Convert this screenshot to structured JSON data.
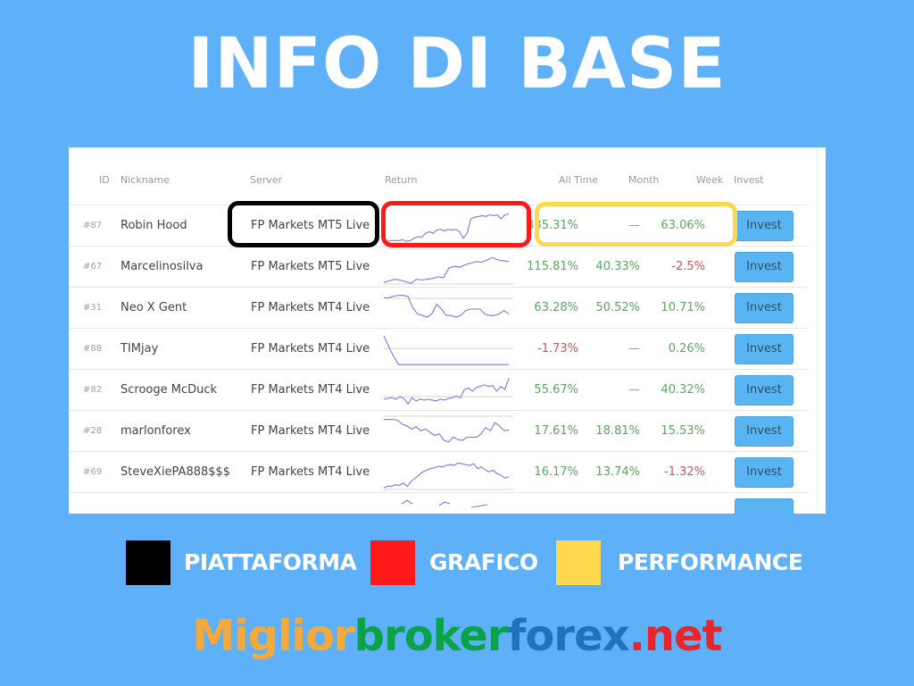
{
  "title": "INFO DI BASE",
  "table": {
    "headers": {
      "id": "ID",
      "nickname": "Nickname",
      "server": "Server",
      "return": "Return",
      "all_time": "All Time",
      "month": "Month",
      "week": "Week",
      "invest": "Invest"
    },
    "rows": [
      {
        "id": "#87",
        "nickname": "Robin Hood",
        "server": "FP Markets MT5 Live",
        "all_time": "385.31%",
        "all_time_sign": "pos",
        "month": "—",
        "month_sign": "dash",
        "week": "63.06%",
        "week_sign": "pos",
        "invest_label": "Invest",
        "spark": [
          2,
          2,
          3,
          3,
          3,
          4,
          2,
          3,
          6,
          8,
          7,
          12,
          14,
          12,
          16,
          17,
          15,
          17,
          16,
          17,
          14,
          6,
          12,
          30,
          32,
          33,
          34,
          33,
          35,
          34,
          35,
          30,
          35,
          36
        ]
      },
      {
        "id": "#67",
        "nickname": "Marcelinosilva",
        "server": "FP Markets MT5 Live",
        "all_time": "115.81%",
        "all_time_sign": "pos",
        "month": "40.33%",
        "month_sign": "pos",
        "week": "-2.5%",
        "week_sign": "neg",
        "invest_label": "Invest",
        "spark": [
          2,
          4,
          6,
          5,
          3,
          1,
          6,
          5,
          6,
          7,
          9,
          8,
          20,
          22,
          21,
          24,
          26,
          28,
          27,
          30,
          33,
          30,
          29,
          28
        ]
      },
      {
        "id": "#31",
        "nickname": "Neo X Gent",
        "server": "FP Markets MT4 Live",
        "all_time": "63.28%",
        "all_time_sign": "pos",
        "month": "50.52%",
        "month_sign": "pos",
        "week": "10.71%",
        "week_sign": "pos",
        "invest_label": "Invest",
        "spark": [
          34,
          34,
          36,
          37,
          37,
          36,
          22,
          14,
          12,
          10,
          14,
          26,
          20,
          12,
          12,
          10,
          12,
          18,
          20,
          20,
          20,
          14,
          12,
          12,
          14,
          18,
          14
        ]
      },
      {
        "id": "#88",
        "nickname": "TIMjay",
        "server": "FP Markets MT4 Live",
        "all_time": "-1.73%",
        "all_time_sign": "neg",
        "month": "—",
        "month_sign": "dash",
        "week": "0.26%",
        "week_sign": "pos",
        "invest_label": "Invest",
        "spark": [
          38,
          18,
          2,
          2,
          2,
          2,
          2,
          2,
          2,
          2,
          2,
          2,
          2,
          2,
          2,
          2,
          2,
          2
        ]
      },
      {
        "id": "#82",
        "nickname": "Scrooge McDuck",
        "server": "FP Markets MT4 Live",
        "all_time": "55.67%",
        "all_time_sign": "pos",
        "month": "—",
        "month_sign": "dash",
        "week": "40.32%",
        "week_sign": "pos",
        "invest_label": "Invest",
        "spark": [
          10,
          11,
          12,
          10,
          13,
          11,
          4,
          12,
          8,
          10,
          9,
          10,
          9,
          8,
          10,
          9,
          11,
          12,
          14,
          12,
          22,
          24,
          20,
          25,
          26,
          28,
          26,
          27,
          20,
          26,
          22,
          36
        ]
      },
      {
        "id": "#28",
        "nickname": "marlonforex",
        "server": "FP Markets MT4 Live",
        "all_time": "17.61%",
        "all_time_sign": "pos",
        "month": "18.81%",
        "month_sign": "pos",
        "week": "15.53%",
        "week_sign": "pos",
        "invest_label": "Invest",
        "spark": [
          36,
          36,
          36,
          35,
          30,
          28,
          24,
          27,
          22,
          24,
          20,
          16,
          18,
          10,
          8,
          14,
          11,
          10,
          14,
          14,
          14,
          18,
          26,
          22,
          32,
          28,
          22,
          23
        ]
      },
      {
        "id": "#69",
        "nickname": "SteveXiePA888$$$",
        "server": "FP Markets MT4 Live",
        "all_time": "16.17%",
        "all_time_sign": "pos",
        "month": "13.74%",
        "month_sign": "pos",
        "week": "-1.32%",
        "week_sign": "neg",
        "invest_label": "Invest",
        "spark": [
          2,
          4,
          4,
          6,
          5,
          8,
          4,
          10,
          14,
          18,
          22,
          24,
          26,
          27,
          29,
          28,
          30,
          31,
          30,
          33,
          32,
          31,
          30,
          32,
          26,
          28,
          24,
          22,
          24,
          20,
          18,
          14,
          16
        ]
      }
    ],
    "partial_row_sparks": [
      [
        6,
        10,
        6
      ],
      [
        4,
        8,
        6
      ],
      [
        2,
        3,
        4,
        5
      ]
    ]
  },
  "legend": [
    {
      "label": "PIATTAFORMA",
      "color": "#000000"
    },
    {
      "label": "GRAFICO",
      "color": "#ff1a1a"
    },
    {
      "label": "PERFORMANCE",
      "color": "#ffd84d"
    }
  ],
  "footer": {
    "parts": [
      {
        "text": "Miglior",
        "color": "#f6a93b"
      },
      {
        "text": "broker",
        "color": "#0ba34a"
      },
      {
        "text": "forex",
        "color": "#1f73b9"
      },
      {
        "text": ".net",
        "color": "#e8252a"
      }
    ]
  },
  "colors": {
    "background": "#5eb1f9",
    "positive": "#5aa85c",
    "negative": "#d0545c",
    "invest_button": "#59b5f2",
    "sparkline": "#7a7ae0"
  }
}
